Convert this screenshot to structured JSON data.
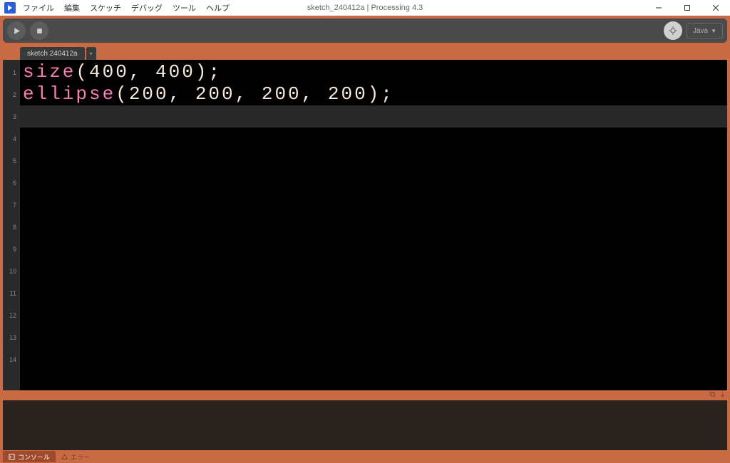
{
  "window": {
    "title": "sketch_240412a | Processing 4.3"
  },
  "menus": [
    "ファイル",
    "編集",
    "スケッチ",
    "デバッグ",
    "ツール",
    "ヘルプ"
  ],
  "toolbar": {
    "mode_label": "Java"
  },
  "tabs": [
    {
      "label": "sketch 240412a"
    }
  ],
  "editor": {
    "total_lines": 14,
    "current_line": 3,
    "lines": [
      {
        "kw": "size",
        "rest": "(400, 400);"
      },
      {
        "kw": "ellipse",
        "rest": "(200, 200, 200, 200);"
      }
    ]
  },
  "bottom": {
    "console_label": "コンソール",
    "errors_label": "エラー"
  }
}
